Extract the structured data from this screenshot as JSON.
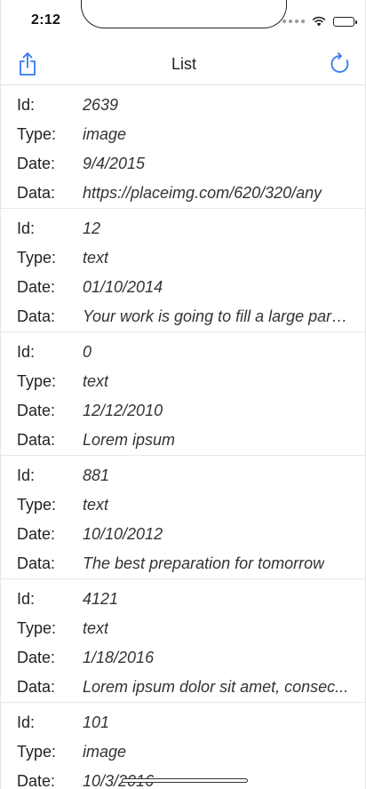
{
  "status_bar": {
    "time": "2:12"
  },
  "nav": {
    "title": "List",
    "accent_color": "#3478f6",
    "left_icon": "share-icon",
    "right_icon": "refresh-icon"
  },
  "labels": {
    "id": "Id:",
    "type": "Type:",
    "date": "Date:",
    "data": "Data:"
  },
  "items": [
    {
      "id": "2639",
      "type": "image",
      "date": "9/4/2015",
      "data": "https://placeimg.com/620/320/any"
    },
    {
      "id": "12",
      "type": "text",
      "date": "01/10/2014",
      "data": "Your work is going to fill a large part..."
    },
    {
      "id": "0",
      "type": "text",
      "date": "12/12/2010",
      "data": "Lorem ipsum"
    },
    {
      "id": "881",
      "type": "text",
      "date": "10/10/2012",
      "data": "The best preparation for tomorrow"
    },
    {
      "id": "4121",
      "type": "text",
      "date": "1/18/2016",
      "data": "Lorem ipsum dolor sit amet, consec..."
    },
    {
      "id": "101",
      "type": "image",
      "date": "10/3/2016",
      "data": ""
    }
  ]
}
